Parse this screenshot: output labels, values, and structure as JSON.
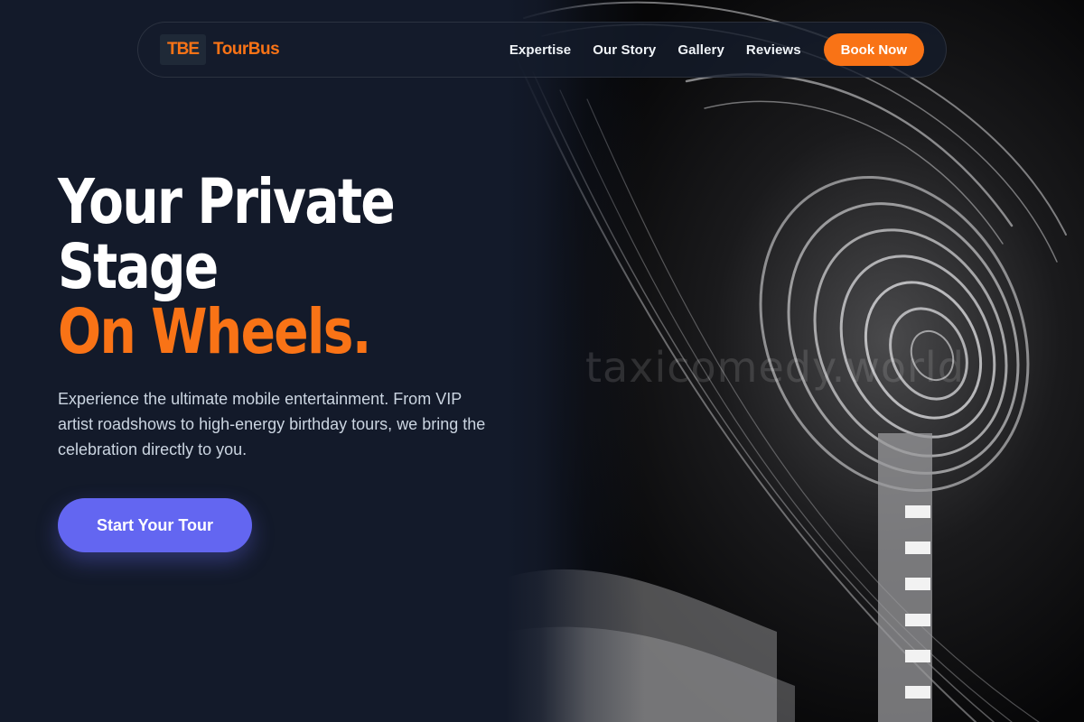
{
  "nav": {
    "logo_badge": "TBE",
    "logo_text": "TourBus",
    "links": [
      "Expertise",
      "Our Story",
      "Gallery",
      "Reviews"
    ],
    "book_label": "Book Now"
  },
  "hero": {
    "headline_line1": "Your Private",
    "headline_line2": "Stage",
    "headline_accent": "On Wheels.",
    "subtitle": "Experience the ultimate mobile entertainment. From VIP artist roadshows to high-energy birthday tours, we bring the celebration directly to you.",
    "cta_label": "Start Your Tour",
    "watermark": "taxicomedy.world"
  },
  "colors": {
    "background": "#131a2a",
    "accent": "#f97316",
    "cta": "#6366f1",
    "text_muted": "#cbd5e1"
  },
  "icons": [
    "ferris-wheel-photo"
  ]
}
